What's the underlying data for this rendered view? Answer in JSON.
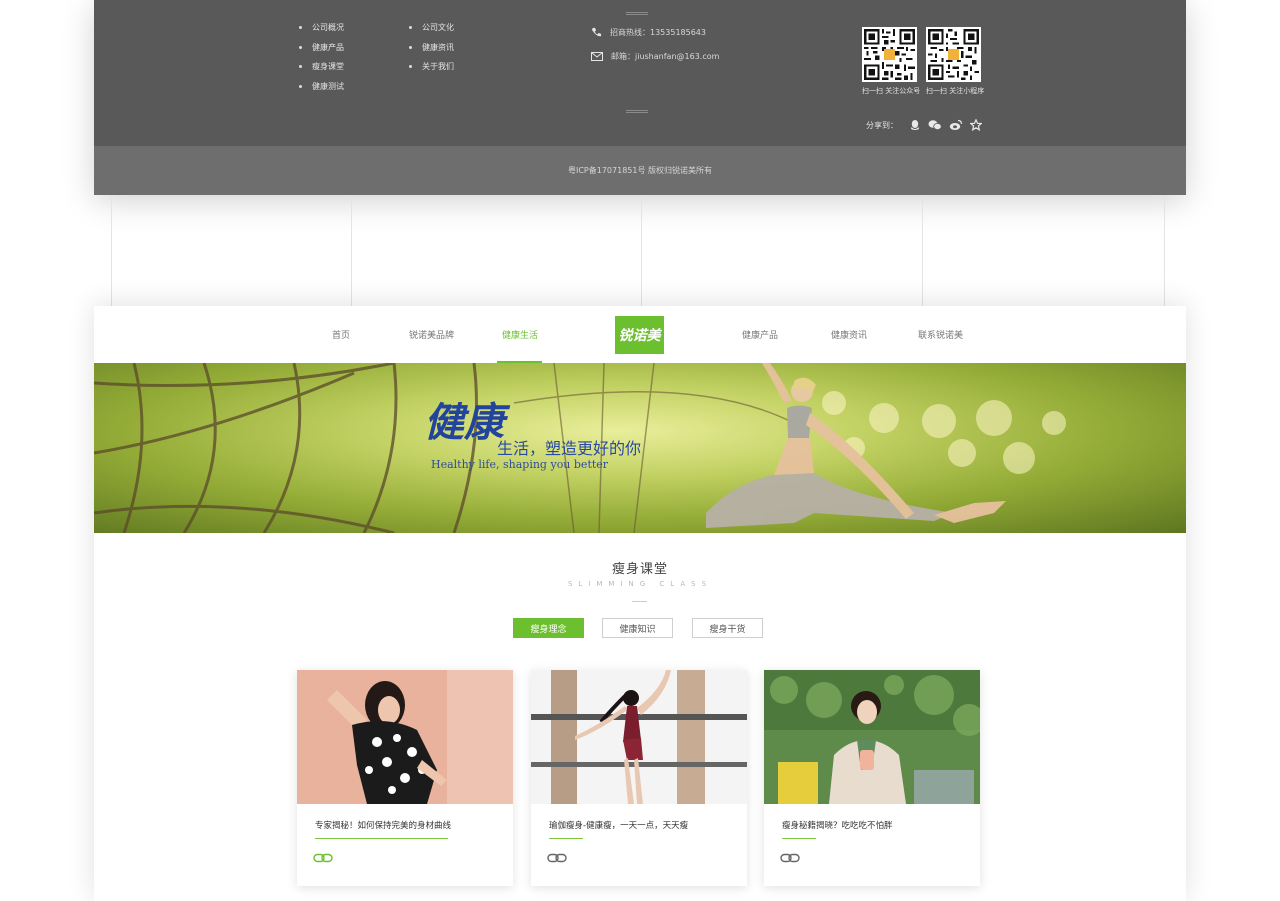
{
  "footer": {
    "links_col1": [
      "公司概况",
      "健康产品",
      "瘦身课堂",
      "健康测试"
    ],
    "links_col2": [
      "公司文化",
      "健康资讯",
      "关于我们"
    ],
    "hotline": "招商热线：13535185643",
    "email": "邮箱：jiushanfan@163.com",
    "qr_codes": [
      {
        "label": "扫一扫 关注公众号"
      },
      {
        "label": "扫一扫 关注小程序"
      }
    ],
    "share_label": "分享到：",
    "share_icons": [
      "qq-icon",
      "wechat-icon",
      "weibo-icon",
      "star-icon"
    ],
    "copyright": "粤ICP备17071851号 版权归锐诺美所有"
  },
  "nav": {
    "items_left": [
      "首页",
      "锐诺美品牌",
      "健康生活"
    ],
    "items_right": [
      "健康产品",
      "健康资讯",
      "联系锐诺美"
    ],
    "active": "健康生活",
    "logo_text": "锐诺美"
  },
  "banner": {
    "slogan_big": "健康",
    "slogan_sub": "生活，塑造更好的你",
    "slogan_en": "Healthy life, shaping you better"
  },
  "section": {
    "title": "瘦身课堂",
    "subtitle": "SLIMMING CLASS",
    "tabs": [
      "瘦身理念",
      "健康知识",
      "瘦身干货"
    ],
    "active_tab": "瘦身理念"
  },
  "cards": [
    {
      "title": "专家揭秘！如何保持完美的身材曲线"
    },
    {
      "title": "瑜伽瘦身-健康瘦，一天一点，天天瘦"
    },
    {
      "title": "瘦身秘籍揭晓？吃吃吃不怕胖"
    }
  ],
  "colors": {
    "accent": "#6cbf2f",
    "footer_dark": "#595959",
    "footer_light": "#6e6e6e",
    "slogan_blue": "#23449c"
  }
}
